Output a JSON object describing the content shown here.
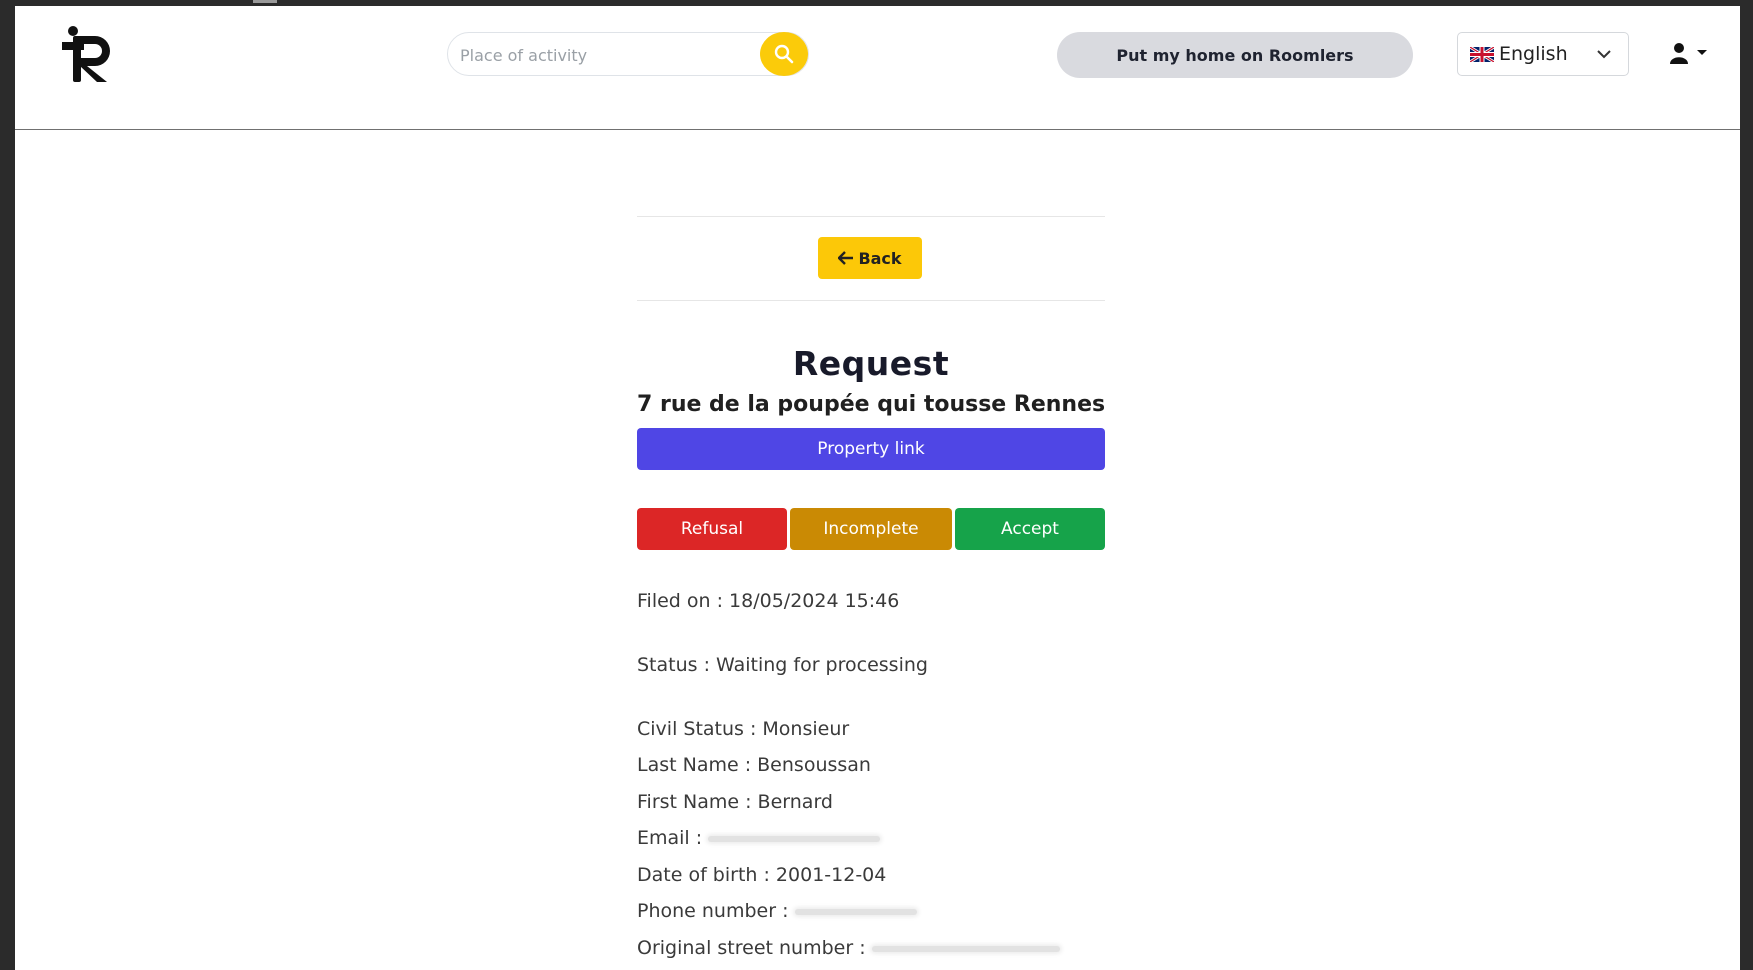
{
  "header": {
    "search_placeholder": "Place of activity",
    "cta_label": "Put my home on Roomlers",
    "language": "English"
  },
  "main": {
    "back_label": "Back",
    "title": "Request",
    "address": "7 rue de la poupée qui tousse Rennes",
    "property_link_label": "Property link",
    "actions": {
      "refusal": "Refusal",
      "incomplete": "Incomplete",
      "accept": "Accept"
    },
    "details": {
      "filed_on": "Filed on : 18/05/2024 15:46",
      "status": "Status : Waiting for processing",
      "civil_status": "Civil Status : Monsieur",
      "last_name": "Last Name : Bensoussan",
      "first_name": "First Name : Bernard",
      "email_label": "Email :",
      "date_of_birth": "Date of birth : 2001-12-04",
      "phone_label": "Phone number :",
      "street_number_label": "Original street number :"
    }
  },
  "colors": {
    "accent_yellow": "#fcc808",
    "property_link": "#4f46e5",
    "refusal": "#dc2626",
    "incomplete": "#ca8a04",
    "accept": "#16a34a"
  }
}
